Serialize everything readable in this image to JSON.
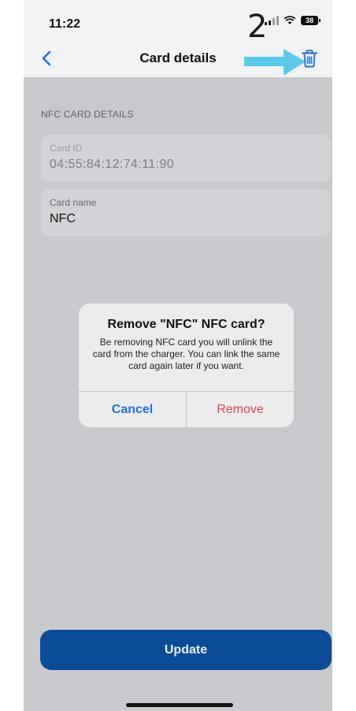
{
  "status_bar": {
    "time": "11:22",
    "battery": "38"
  },
  "annotation": {
    "number": "2"
  },
  "nav": {
    "title": "Card details"
  },
  "section": {
    "label": "NFC CARD DETAILS"
  },
  "fields": {
    "card_id": {
      "label": "Card ID",
      "value": "04:55:84:12:74:11:90"
    },
    "card_name": {
      "label": "Card name",
      "value": "NFC"
    }
  },
  "dialog": {
    "title": "Remove \"NFC\" NFC card?",
    "message": "Be removing NFC card you will unlink the card from the charger. You can link the same card again later if you want.",
    "cancel_label": "Cancel",
    "remove_label": "Remove"
  },
  "footer": {
    "update_label": "Update"
  },
  "colors": {
    "accent": "#0c4c97",
    "link_blue": "#1f73d6",
    "destructive": "#e0474c",
    "annotation_arrow": "#5bc9ea"
  },
  "icons": [
    "back-chevron-icon",
    "trash-icon",
    "annotation-arrow-icon",
    "signal-icon",
    "wifi-icon",
    "battery-icon"
  ]
}
